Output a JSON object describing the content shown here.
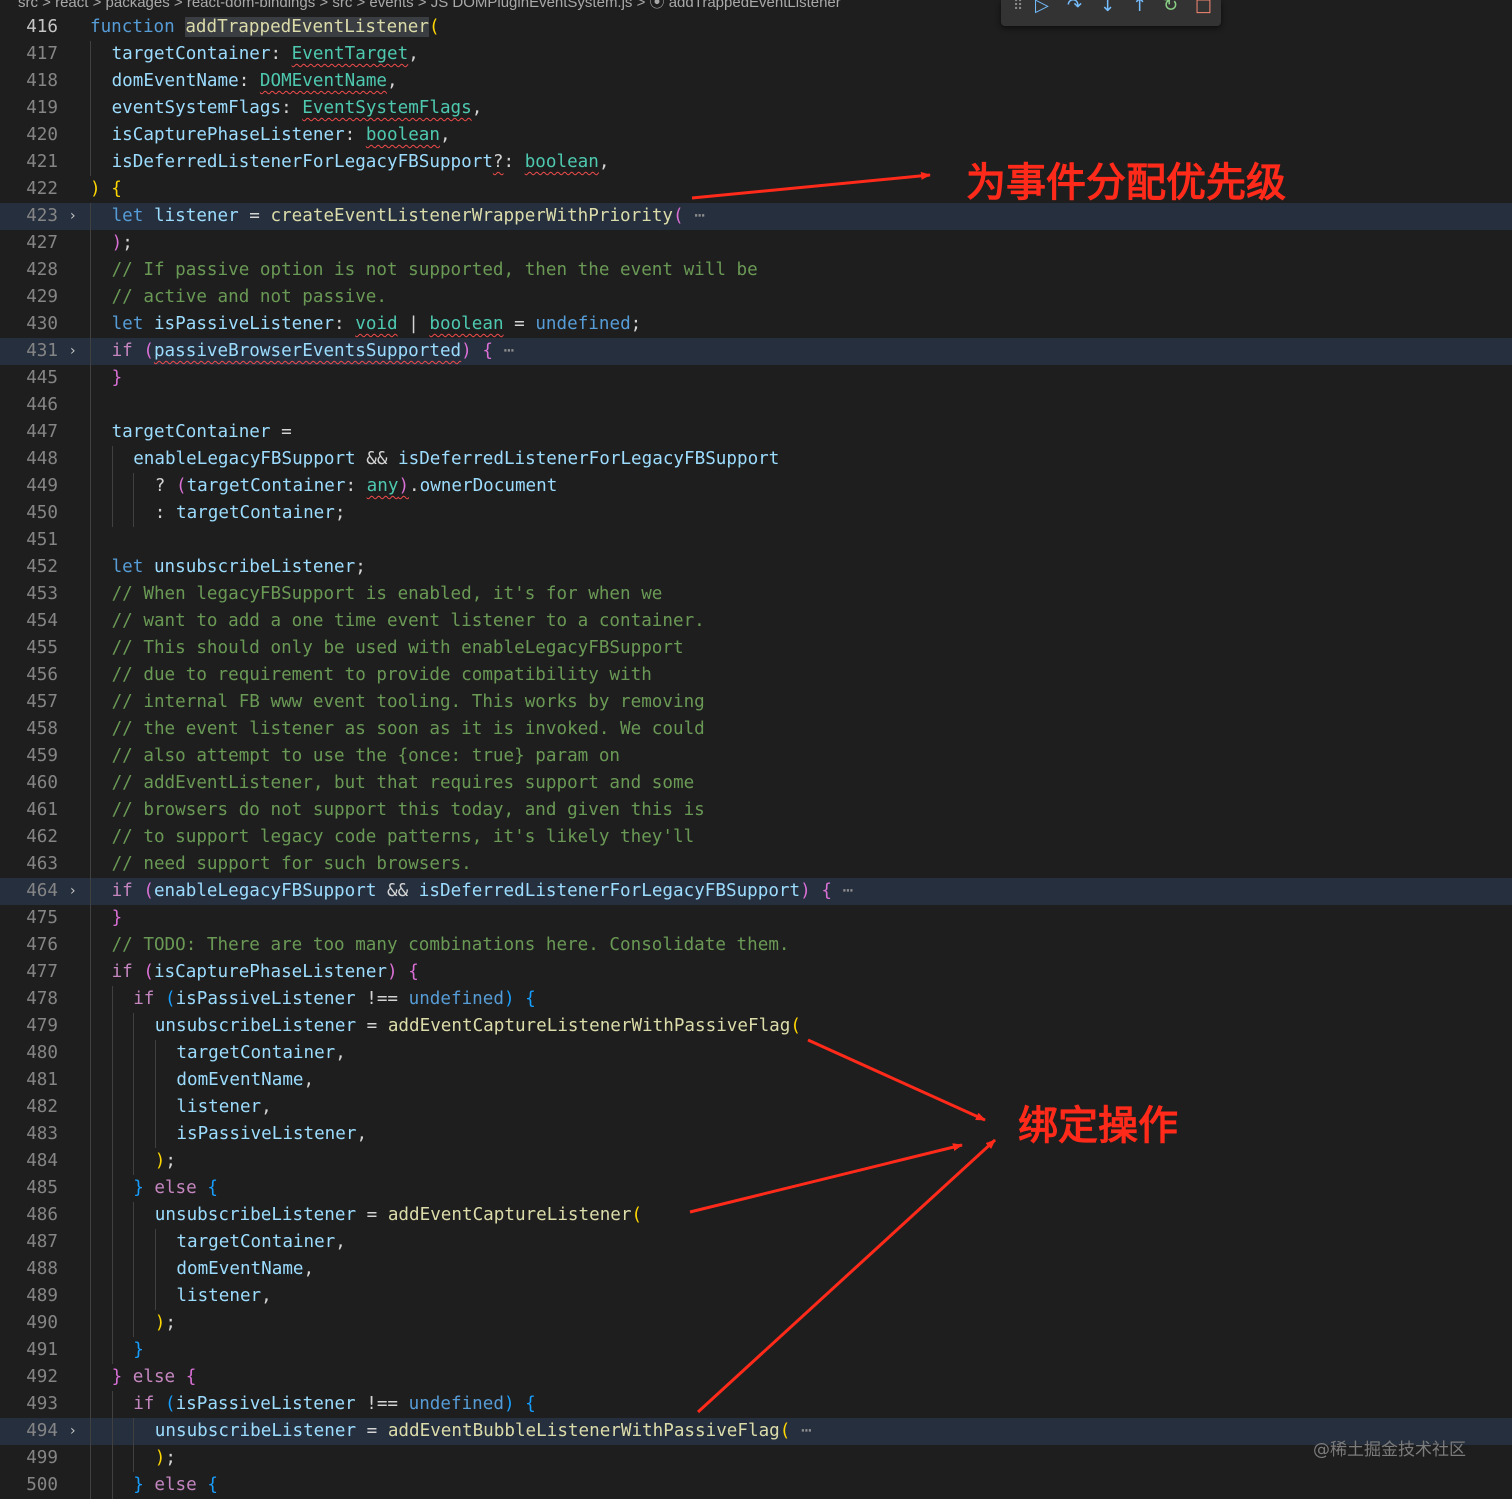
{
  "breadcrumb": {
    "path": "src > react > packages > react-dom-bindings > src > events > JS DOMPluginEventSystem.js > ⦿ addTrappedEventListener"
  },
  "debug_toolbar": {
    "grip": "⠿",
    "continue": "▷",
    "step_over": "↷",
    "step_into": "↓",
    "step_out": "↑",
    "restart": "↻",
    "stop": "□"
  },
  "lines": [
    {
      "n": "416",
      "current": true,
      "tokens": [
        [
          "kw",
          "function "
        ],
        [
          "fn hlw",
          "addTrappedEventListener"
        ],
        [
          "b1",
          "("
        ]
      ]
    },
    {
      "n": "417",
      "indent": 1,
      "tokens": [
        [
          "var",
          "targetContainer"
        ],
        [
          "op",
          ": "
        ],
        [
          "ty sq",
          "EventTarget"
        ],
        [
          "op",
          ","
        ]
      ]
    },
    {
      "n": "418",
      "indent": 1,
      "tokens": [
        [
          "var",
          "domEventName"
        ],
        [
          "op",
          ": "
        ],
        [
          "ty sq",
          "DOMEventName"
        ],
        [
          "op",
          ","
        ]
      ]
    },
    {
      "n": "419",
      "indent": 1,
      "tokens": [
        [
          "var",
          "eventSystemFlags"
        ],
        [
          "op",
          ": "
        ],
        [
          "ty sq",
          "EventSystemFlags"
        ],
        [
          "op",
          ","
        ]
      ]
    },
    {
      "n": "420",
      "indent": 1,
      "tokens": [
        [
          "var",
          "isCapturePhaseListener"
        ],
        [
          "op",
          ": "
        ],
        [
          "ty sq",
          "boolean"
        ],
        [
          "op",
          ","
        ]
      ]
    },
    {
      "n": "421",
      "indent": 1,
      "tokens": [
        [
          "var",
          "isDeferredListenerForLegacyFBSupport"
        ],
        [
          "op sq",
          "?"
        ],
        [
          "op",
          ": "
        ],
        [
          "ty sq",
          "boolean"
        ],
        [
          "op",
          ","
        ]
      ]
    },
    {
      "n": "422",
      "tokens": [
        [
          "b1",
          ")"
        ],
        [
          "op",
          " "
        ],
        [
          "b1",
          "{"
        ]
      ]
    },
    {
      "n": "423",
      "indent": 1,
      "fold": true,
      "tokens": [
        [
          "kw",
          "let "
        ],
        [
          "var",
          "listener"
        ],
        [
          "op",
          " = "
        ],
        [
          "fn",
          "createEventListenerWrapperWithPriority"
        ],
        [
          "b2",
          "("
        ],
        [
          "ell",
          " ⋯"
        ]
      ]
    },
    {
      "n": "427",
      "indent": 1,
      "tokens": [
        [
          "b2",
          ")"
        ],
        [
          "op",
          ";"
        ]
      ]
    },
    {
      "n": "428",
      "indent": 1,
      "tokens": [
        [
          "cm",
          "// If passive option is not supported, then the event will be"
        ]
      ]
    },
    {
      "n": "429",
      "indent": 1,
      "tokens": [
        [
          "cm",
          "// active and not passive."
        ]
      ]
    },
    {
      "n": "430",
      "indent": 1,
      "tokens": [
        [
          "kw",
          "let "
        ],
        [
          "var",
          "isPassiveListener"
        ],
        [
          "op",
          ": "
        ],
        [
          "ty sq",
          "void"
        ],
        [
          "op",
          " | "
        ],
        [
          "ty sq",
          "boolean"
        ],
        [
          "op",
          " = "
        ],
        [
          "kw",
          "undefined"
        ],
        [
          "op",
          ";"
        ]
      ]
    },
    {
      "n": "431",
      "indent": 1,
      "fold": true,
      "tokens": [
        [
          "ctl",
          "if "
        ],
        [
          "b2",
          "("
        ],
        [
          "var sq",
          "passiveBrowserEventsSupported"
        ],
        [
          "b2",
          ")"
        ],
        [
          "op",
          " "
        ],
        [
          "b2",
          "{"
        ],
        [
          "ell",
          " ⋯"
        ]
      ]
    },
    {
      "n": "445",
      "indent": 1,
      "tokens": [
        [
          "b2",
          "}"
        ]
      ]
    },
    {
      "n": "446",
      "indent": 1,
      "tokens": []
    },
    {
      "n": "447",
      "indent": 1,
      "tokens": [
        [
          "var",
          "targetContainer"
        ],
        [
          "op",
          " ="
        ]
      ]
    },
    {
      "n": "448",
      "indent": 2,
      "tokens": [
        [
          "var",
          "enableLegacyFBSupport"
        ],
        [
          "op",
          " && "
        ],
        [
          "var",
          "isDeferredListenerForLegacyFBSupport"
        ]
      ]
    },
    {
      "n": "449",
      "indent": 3,
      "tokens": [
        [
          "op",
          "? "
        ],
        [
          "b2",
          "("
        ],
        [
          "var",
          "targetContainer"
        ],
        [
          "op",
          ": "
        ],
        [
          "ty sq",
          "any"
        ],
        [
          "b2 sq",
          ")"
        ],
        [
          "op",
          "."
        ],
        [
          "var",
          "ownerDocument"
        ]
      ]
    },
    {
      "n": "450",
      "indent": 3,
      "tokens": [
        [
          "op",
          ": "
        ],
        [
          "var",
          "targetContainer"
        ],
        [
          "op",
          ";"
        ]
      ]
    },
    {
      "n": "451",
      "indent": 1,
      "tokens": []
    },
    {
      "n": "452",
      "indent": 1,
      "tokens": [
        [
          "kw",
          "let "
        ],
        [
          "var",
          "unsubscribeListener"
        ],
        [
          "op",
          ";"
        ]
      ]
    },
    {
      "n": "453",
      "indent": 1,
      "tokens": [
        [
          "cm",
          "// When legacyFBSupport is enabled, it's for when we"
        ]
      ]
    },
    {
      "n": "454",
      "indent": 1,
      "tokens": [
        [
          "cm",
          "// want to add a one time event listener to a container."
        ]
      ]
    },
    {
      "n": "455",
      "indent": 1,
      "tokens": [
        [
          "cm",
          "// This should only be used with enableLegacyFBSupport"
        ]
      ]
    },
    {
      "n": "456",
      "indent": 1,
      "tokens": [
        [
          "cm",
          "// due to requirement to provide compatibility with"
        ]
      ]
    },
    {
      "n": "457",
      "indent": 1,
      "tokens": [
        [
          "cm",
          "// internal FB www event tooling. This works by removing"
        ]
      ]
    },
    {
      "n": "458",
      "indent": 1,
      "tokens": [
        [
          "cm",
          "// the event listener as soon as it is invoked. We could"
        ]
      ]
    },
    {
      "n": "459",
      "indent": 1,
      "tokens": [
        [
          "cm",
          "// also attempt to use the {once: true} param on"
        ]
      ]
    },
    {
      "n": "460",
      "indent": 1,
      "tokens": [
        [
          "cm",
          "// addEventListener, but that requires support and some"
        ]
      ]
    },
    {
      "n": "461",
      "indent": 1,
      "tokens": [
        [
          "cm",
          "// browsers do not support this today, and given this is"
        ]
      ]
    },
    {
      "n": "462",
      "indent": 1,
      "tokens": [
        [
          "cm",
          "// to support legacy code patterns, it's likely they'll"
        ]
      ]
    },
    {
      "n": "463",
      "indent": 1,
      "tokens": [
        [
          "cm",
          "// need support for such browsers."
        ]
      ]
    },
    {
      "n": "464",
      "indent": 1,
      "fold": true,
      "tokens": [
        [
          "ctl",
          "if "
        ],
        [
          "b2",
          "("
        ],
        [
          "var",
          "enableLegacyFBSupport"
        ],
        [
          "op",
          " && "
        ],
        [
          "var",
          "isDeferredListenerForLegacyFBSupport"
        ],
        [
          "b2",
          ")"
        ],
        [
          "op",
          " "
        ],
        [
          "b2",
          "{"
        ],
        [
          "ell",
          " ⋯"
        ]
      ]
    },
    {
      "n": "475",
      "indent": 1,
      "tokens": [
        [
          "b2",
          "}"
        ]
      ]
    },
    {
      "n": "476",
      "indent": 1,
      "tokens": [
        [
          "cm",
          "// TODO: There are too many combinations here. Consolidate them."
        ]
      ]
    },
    {
      "n": "477",
      "indent": 1,
      "tokens": [
        [
          "ctl",
          "if "
        ],
        [
          "b2",
          "("
        ],
        [
          "var",
          "isCapturePhaseListener"
        ],
        [
          "b2",
          ")"
        ],
        [
          "op",
          " "
        ],
        [
          "b2",
          "{"
        ]
      ]
    },
    {
      "n": "478",
      "indent": 2,
      "tokens": [
        [
          "ctl",
          "if "
        ],
        [
          "b3",
          "("
        ],
        [
          "var",
          "isPassiveListener"
        ],
        [
          "op",
          " !== "
        ],
        [
          "kw",
          "undefined"
        ],
        [
          "b3",
          ")"
        ],
        [
          "op",
          " "
        ],
        [
          "b3",
          "{"
        ]
      ]
    },
    {
      "n": "479",
      "indent": 3,
      "tokens": [
        [
          "var",
          "unsubscribeListener"
        ],
        [
          "op",
          " = "
        ],
        [
          "fn",
          "addEventCaptureListenerWithPassiveFlag"
        ],
        [
          "b1",
          "("
        ]
      ]
    },
    {
      "n": "480",
      "indent": 4,
      "tokens": [
        [
          "var",
          "targetContainer"
        ],
        [
          "op",
          ","
        ]
      ]
    },
    {
      "n": "481",
      "indent": 4,
      "tokens": [
        [
          "var",
          "domEventName"
        ],
        [
          "op",
          ","
        ]
      ]
    },
    {
      "n": "482",
      "indent": 4,
      "tokens": [
        [
          "var",
          "listener"
        ],
        [
          "op",
          ","
        ]
      ]
    },
    {
      "n": "483",
      "indent": 4,
      "tokens": [
        [
          "var",
          "isPassiveListener"
        ],
        [
          "op",
          ","
        ]
      ]
    },
    {
      "n": "484",
      "indent": 3,
      "tokens": [
        [
          "b1",
          ")"
        ],
        [
          "op",
          ";"
        ]
      ]
    },
    {
      "n": "485",
      "indent": 2,
      "tokens": [
        [
          "b3",
          "}"
        ],
        [
          "op",
          " "
        ],
        [
          "ctl",
          "else"
        ],
        [
          "op",
          " "
        ],
        [
          "b3",
          "{"
        ]
      ]
    },
    {
      "n": "486",
      "indent": 3,
      "tokens": [
        [
          "var",
          "unsubscribeListener"
        ],
        [
          "op",
          " = "
        ],
        [
          "fn",
          "addEventCaptureListener"
        ],
        [
          "b1",
          "("
        ]
      ]
    },
    {
      "n": "487",
      "indent": 4,
      "tokens": [
        [
          "var",
          "targetContainer"
        ],
        [
          "op",
          ","
        ]
      ]
    },
    {
      "n": "488",
      "indent": 4,
      "tokens": [
        [
          "var",
          "domEventName"
        ],
        [
          "op",
          ","
        ]
      ]
    },
    {
      "n": "489",
      "indent": 4,
      "tokens": [
        [
          "var",
          "listener"
        ],
        [
          "op",
          ","
        ]
      ]
    },
    {
      "n": "490",
      "indent": 3,
      "tokens": [
        [
          "b1",
          ")"
        ],
        [
          "op",
          ";"
        ]
      ]
    },
    {
      "n": "491",
      "indent": 2,
      "tokens": [
        [
          "b3",
          "}"
        ]
      ]
    },
    {
      "n": "492",
      "indent": 1,
      "tokens": [
        [
          "b2",
          "}"
        ],
        [
          "op",
          " "
        ],
        [
          "ctl",
          "else"
        ],
        [
          "op",
          " "
        ],
        [
          "b2",
          "{"
        ]
      ]
    },
    {
      "n": "493",
      "indent": 2,
      "tokens": [
        [
          "ctl",
          "if "
        ],
        [
          "b3",
          "("
        ],
        [
          "var",
          "isPassiveListener"
        ],
        [
          "op",
          " !== "
        ],
        [
          "kw",
          "undefined"
        ],
        [
          "b3",
          ")"
        ],
        [
          "op",
          " "
        ],
        [
          "b3",
          "{"
        ]
      ]
    },
    {
      "n": "494",
      "indent": 3,
      "fold": true,
      "tokens": [
        [
          "var",
          "unsubscribeListener"
        ],
        [
          "op",
          " = "
        ],
        [
          "fn",
          "addEventBubbleListenerWithPassiveFlag"
        ],
        [
          "b1",
          "("
        ],
        [
          "ell",
          " ⋯"
        ]
      ]
    },
    {
      "n": "499",
      "indent": 3,
      "tokens": [
        [
          "b1",
          ")"
        ],
        [
          "op",
          ";"
        ]
      ]
    },
    {
      "n": "500",
      "indent": 2,
      "tokens": [
        [
          "b3",
          "}"
        ],
        [
          "op",
          " "
        ],
        [
          "ctl",
          "else"
        ],
        [
          "op",
          " "
        ],
        [
          "b3",
          "{"
        ]
      ]
    }
  ],
  "annotations": {
    "priority_label": "为事件分配优先级",
    "binding_label": "绑定操作",
    "color": "#ff2a1a"
  },
  "watermark": "@稀土掘金技术社区"
}
